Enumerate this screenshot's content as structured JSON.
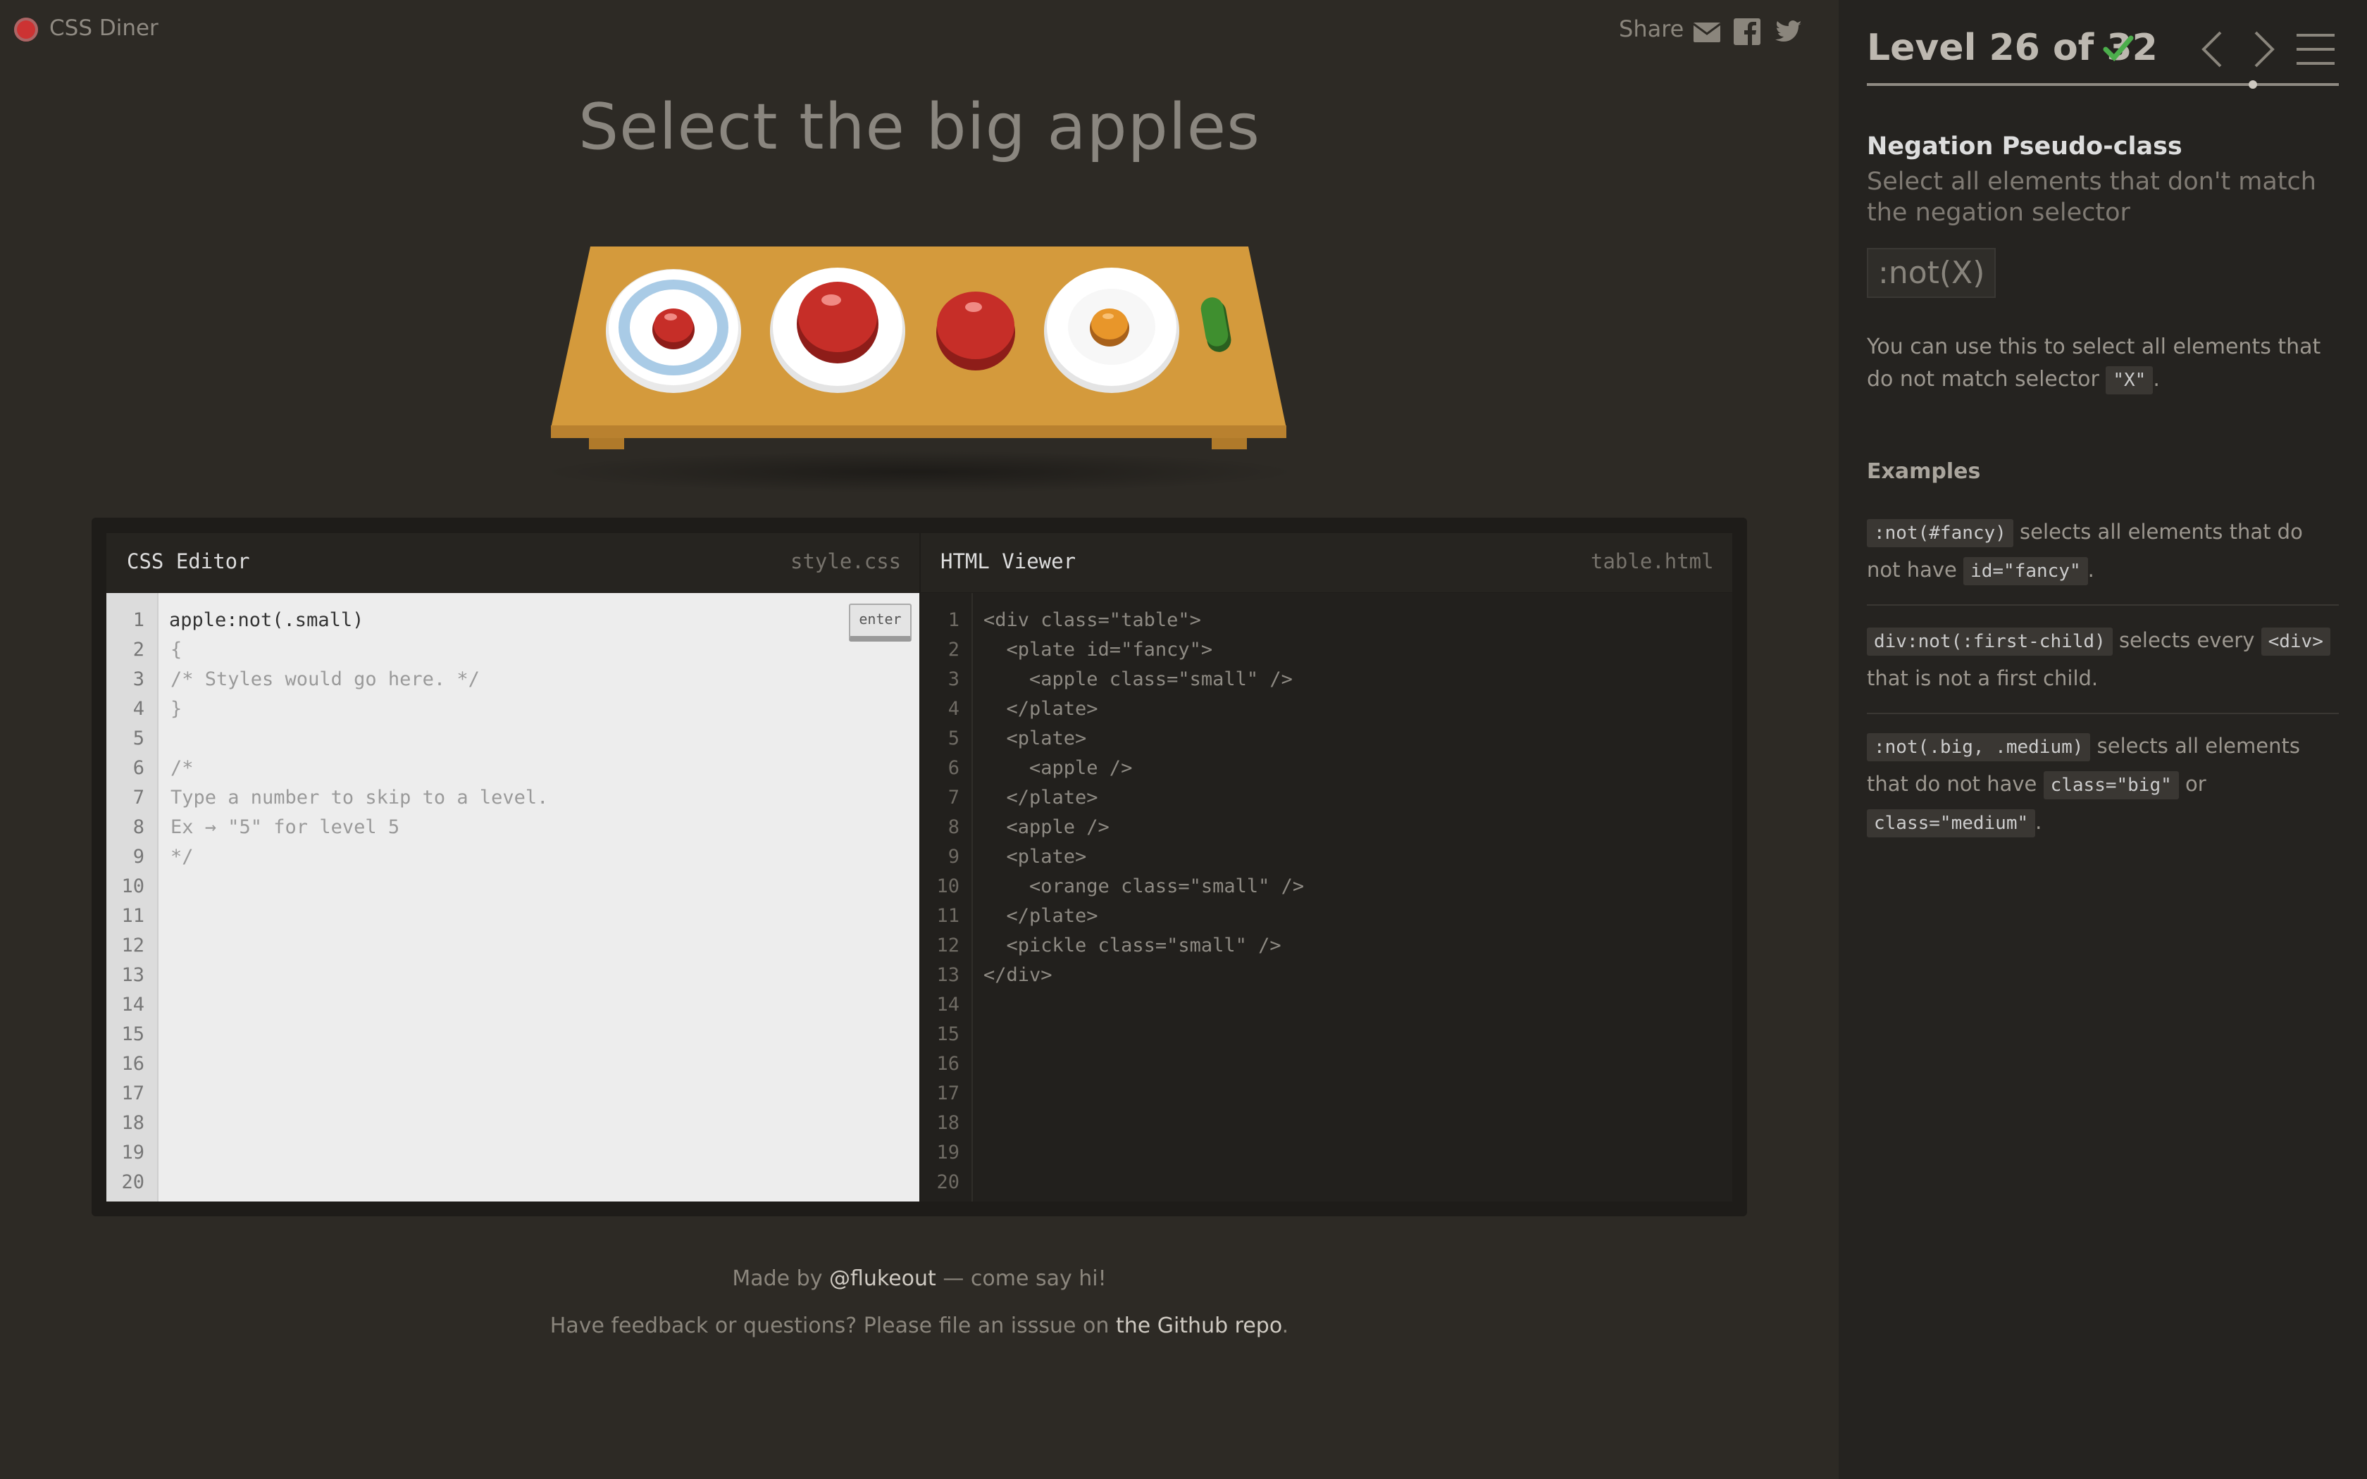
{
  "app": {
    "title": "CSS Diner"
  },
  "share": {
    "label": "Share",
    "icons": [
      "email-icon",
      "facebook-icon",
      "twitter-icon"
    ]
  },
  "order": "Select the big apples",
  "editor": {
    "css_title": "CSS Editor",
    "css_file": "style.css",
    "enter_label": "enter",
    "input_value": "apple:not(.small)",
    "css_lines": [
      "",
      "{",
      "/* Styles would go here. */",
      "}",
      "",
      "/*",
      "Type a number to skip to a level.",
      "Ex → \"5\" for level 5",
      "*/"
    ],
    "html_title": "HTML Viewer",
    "html_file": "table.html",
    "html_lines": [
      "<div class=\"table\">",
      "  <plate id=\"fancy\">",
      "    <apple class=\"small\" />",
      "  </plate>",
      "  <plate>",
      "    <apple />",
      "  </plate>",
      "  <apple />",
      "  <plate>",
      "    <orange class=\"small\" />",
      "  </plate>",
      "  <pickle class=\"small\" />",
      "</div>"
    ],
    "line_count": 20
  },
  "footer": {
    "line1_pre": "Made by ",
    "line1_link": "@flukeout",
    "line1_post": " — come say hi!",
    "line2_pre": "Have feedback or questions? Please file an isssue on ",
    "line2_link": "the Github repo",
    "line2_post": "."
  },
  "sidebar": {
    "level_text": "Level 26 of 32",
    "completed": true,
    "progress": 0.8125,
    "selector_name": "Negation Pseudo-class",
    "title": "Select all elements that don't match the negation selector",
    "syntax": ":not(X)",
    "hint_pre": "You can use this to select all elements that do not match selector ",
    "hint_code": "\"X\"",
    "hint_post": ".",
    "examples_title": "Examples",
    "examples": [
      {
        "code": ":not(#fancy)",
        "t1": " selects all elements that do not have ",
        "code2": "id=\"fancy\"",
        "t2": ".",
        "code3": "",
        "t3": ""
      },
      {
        "code": "div:not(:first-child)",
        "t1": " selects every ",
        "code2": "<div>",
        "t2": " that is not a first child.",
        "code3": "",
        "t3": ""
      },
      {
        "code": ":not(.big, .medium)",
        "t1": " selects all elements that do not have ",
        "code2": "class=\"big\"",
        "t2": " or ",
        "code3": "class=\"medium\"",
        "t3": "."
      }
    ]
  },
  "colors": {
    "accent_check": "#4cae4c",
    "apple": "#c62e28",
    "orange": "#e8962a",
    "pickle": "#3f8f2f",
    "table": "#d49a3c"
  }
}
